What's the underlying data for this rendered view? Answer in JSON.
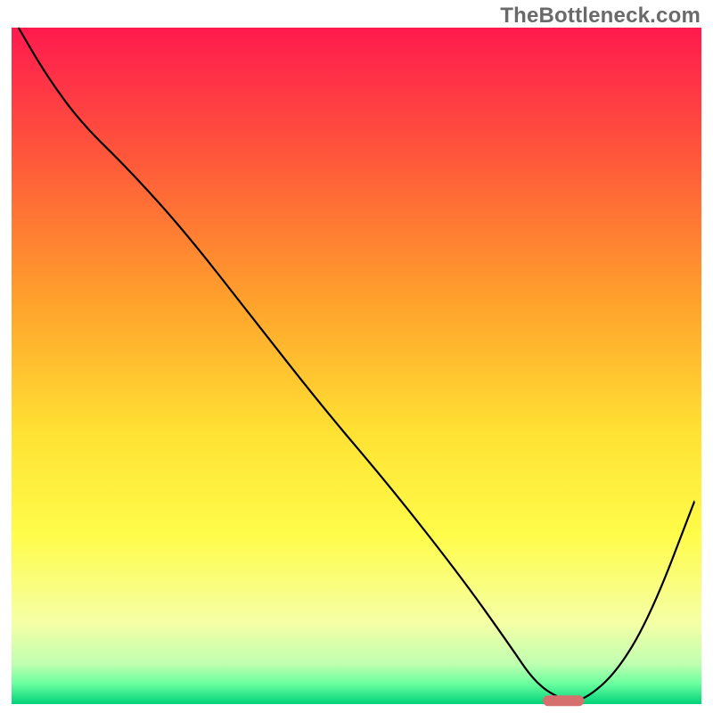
{
  "watermark": "TheBottleneck.com",
  "chart_data": {
    "type": "line",
    "title": "",
    "xlabel": "",
    "ylabel": "",
    "xlim": [
      0,
      100
    ],
    "ylim": [
      0,
      100
    ],
    "grid": false,
    "legend": false,
    "background_gradient": {
      "stops": [
        {
          "offset": 0.0,
          "color": "#ff1a4e"
        },
        {
          "offset": 0.2,
          "color": "#ff5a3a"
        },
        {
          "offset": 0.4,
          "color": "#ffa02c"
        },
        {
          "offset": 0.6,
          "color": "#ffe233"
        },
        {
          "offset": 0.75,
          "color": "#fffc4a"
        },
        {
          "offset": 0.88,
          "color": "#f5ffa6"
        },
        {
          "offset": 0.94,
          "color": "#c0ffb0"
        },
        {
          "offset": 0.97,
          "color": "#6aff9e"
        },
        {
          "offset": 1.0,
          "color": "#00d27a"
        }
      ]
    },
    "series": [
      {
        "name": "bottleneck-curve",
        "x": [
          1,
          5,
          10,
          17,
          25,
          35,
          45,
          55,
          65,
          72,
          76,
          80,
          83,
          88,
          93,
          99
        ],
        "y": [
          100,
          93,
          86,
          79,
          70,
          57,
          44,
          32,
          19,
          9,
          3,
          0.5,
          0.5,
          5,
          14,
          30
        ]
      }
    ],
    "marker": {
      "name": "optimal-range",
      "x_start": 77,
      "x_end": 83,
      "y": 0.5
    }
  }
}
